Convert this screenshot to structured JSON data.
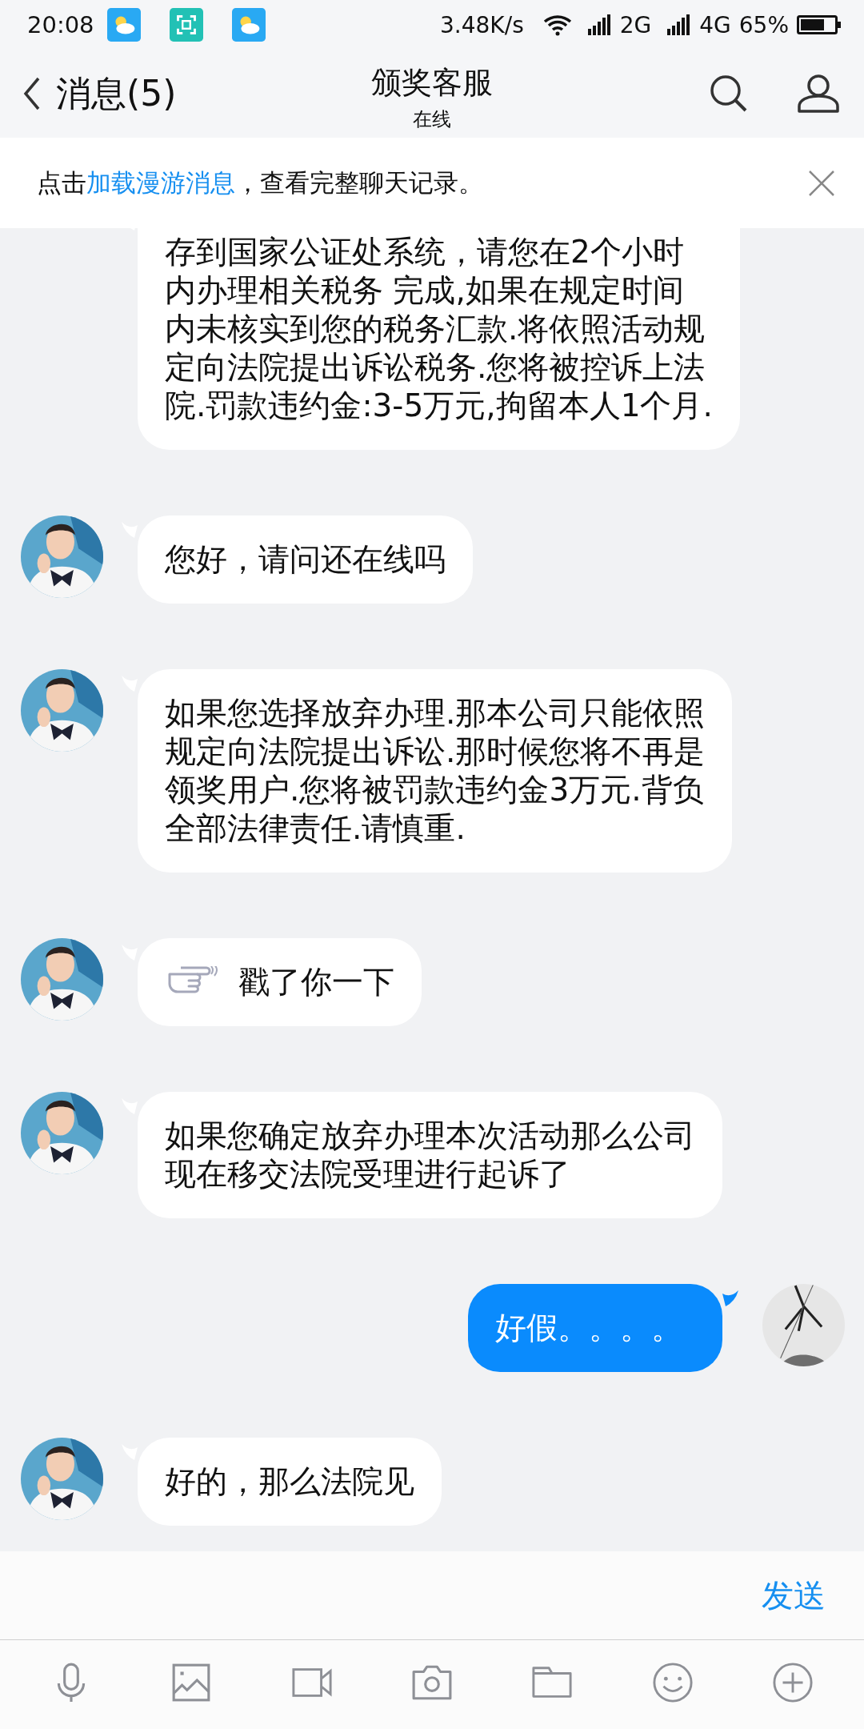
{
  "status_bar": {
    "time": "20:08",
    "net_speed": "3.48K/s",
    "network_1": "2G",
    "network_2": "4G",
    "battery": "65%"
  },
  "header": {
    "back_label": "消息(5)",
    "title": "颁奖客服",
    "subtitle": "在线"
  },
  "banner": {
    "prefix": "点击",
    "link": "加载漫游消息",
    "suffix": "，查看完整聊天记录。"
  },
  "messages": [
    {
      "outgoing": false,
      "kind": "text",
      "lines": [
        "存到国家公证处系统，请您在2个小时",
        "内办理相关税务 完成,如果在规定时间",
        "内未核实到您的税务汇款.将依照活动规",
        "定向法院提出诉讼税务.您将被控诉上法",
        "院.罚款违约金:3-5万元,拘留本人1个月."
      ]
    },
    {
      "outgoing": false,
      "kind": "text",
      "lines": [
        "您好，请问还在线吗"
      ]
    },
    {
      "outgoing": false,
      "kind": "text",
      "lines": [
        "如果您选择放弃办理.那本公司只能依照",
        "规定向法院提出诉讼.那时候您将不再是",
        "领奖用户.您将被罚款违约金3万元.背负",
        "全部法律责任.请慎重."
      ]
    },
    {
      "outgoing": false,
      "kind": "poke",
      "lines": [
        "戳了你一下"
      ]
    },
    {
      "outgoing": false,
      "kind": "text",
      "lines": [
        "如果您确定放弃办理本次活动那么公司",
        "现在移交法院受理进行起诉了"
      ]
    },
    {
      "outgoing": true,
      "kind": "text",
      "lines": [
        "好假。。。。"
      ]
    },
    {
      "outgoing": false,
      "kind": "text",
      "lines": [
        "好的，那么法院见"
      ]
    }
  ],
  "input": {
    "send_button": "发送"
  }
}
